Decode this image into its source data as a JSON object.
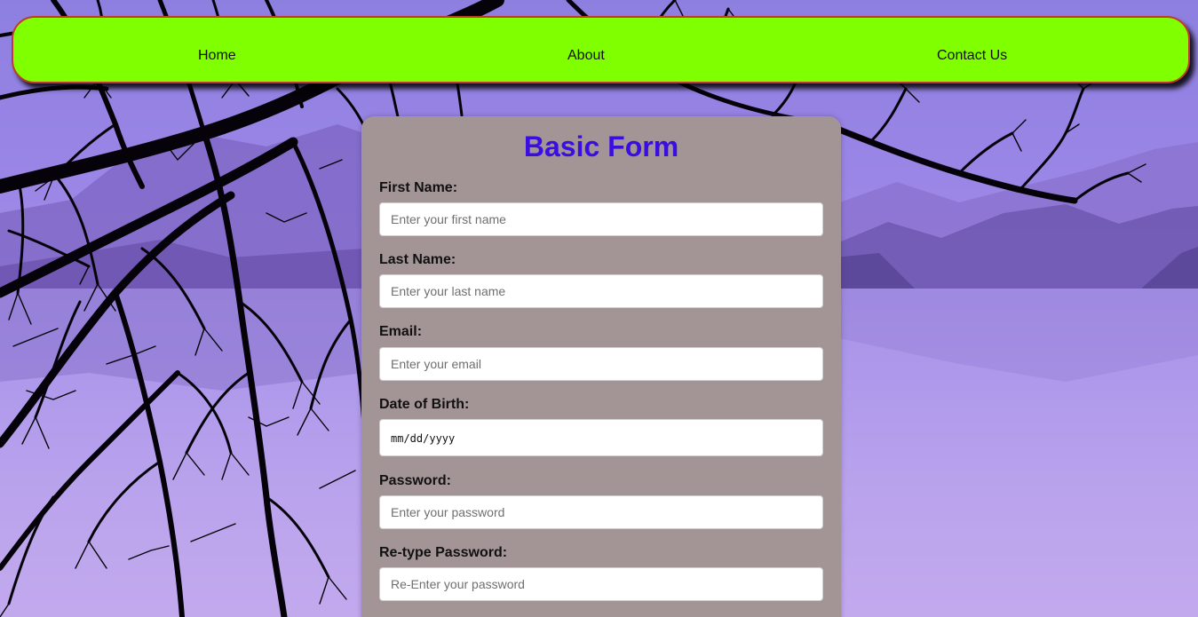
{
  "nav": {
    "home_label": "Home",
    "about_label": "About",
    "contact_label": "Contact Us"
  },
  "form": {
    "title": "Basic Form",
    "first_name": {
      "label": "First Name:",
      "placeholder": "Enter your first name",
      "value": ""
    },
    "last_name": {
      "label": "Last Name:",
      "placeholder": "Enter your last name",
      "value": ""
    },
    "email": {
      "label": "Email:",
      "placeholder": "Enter your email",
      "value": ""
    },
    "dob": {
      "label": "Date of Birth:",
      "placeholder": "mm/dd/yyyy"
    },
    "password": {
      "label": "Password:",
      "placeholder": "Enter your password",
      "value": ""
    },
    "retype_password": {
      "label": "Re-type Password:",
      "placeholder": "Re-Enter your password",
      "value": ""
    }
  },
  "colors": {
    "nav_background": "#80ff00",
    "nav_border": "#c0392b",
    "card_background": "#a39595",
    "title_color": "#3a0ee0",
    "sky": "#9b86e6"
  }
}
